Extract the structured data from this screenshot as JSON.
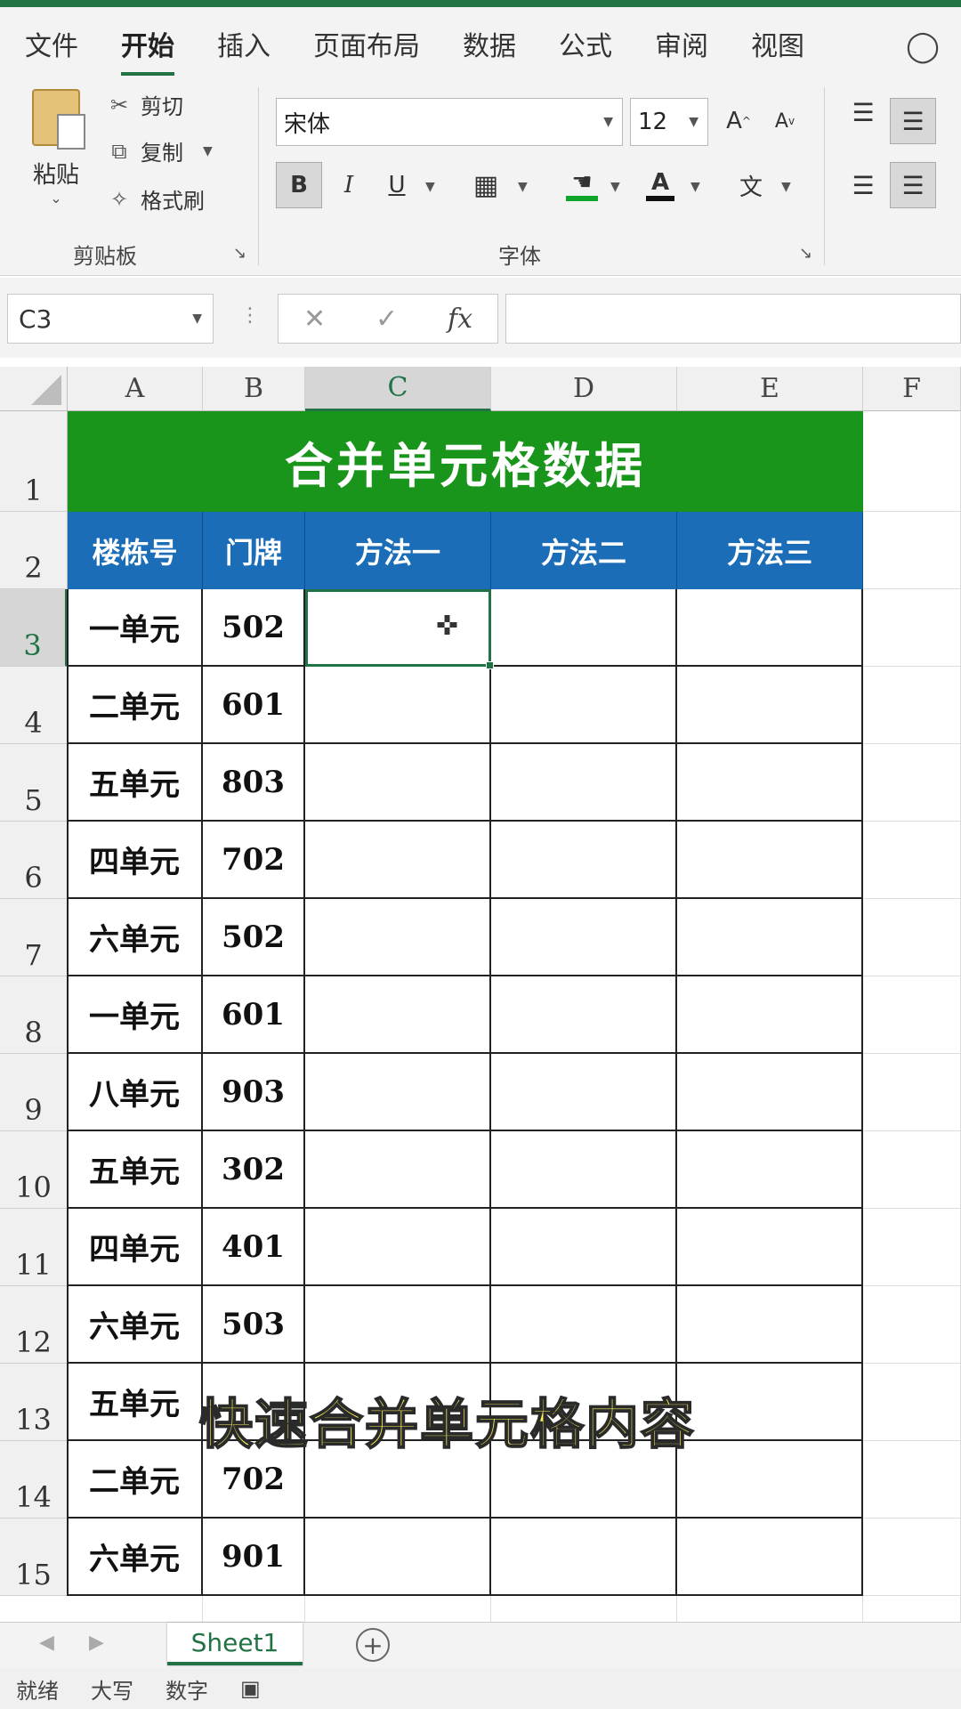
{
  "ribbon_tabs": [
    "文件",
    "开始",
    "插入",
    "页面布局",
    "数据",
    "公式",
    "审阅",
    "视图"
  ],
  "active_tab": "开始",
  "clipboard": {
    "paste_label": "粘贴",
    "cut_label": "剪切",
    "copy_label": "复制",
    "format_painter_label": "格式刷",
    "group_label": "剪贴板"
  },
  "font": {
    "font_name": "宋体",
    "font_size": "12",
    "group_label": "字体",
    "bold": "B",
    "italic": "I",
    "underline": "U",
    "grow": "A",
    "shrink": "A",
    "font_color": "A",
    "phonetic": "文"
  },
  "formula_bar": {
    "name_box": "C3",
    "cancel": "✕",
    "enter": "✓",
    "fx": "fx",
    "formula": ""
  },
  "columns": [
    "A",
    "B",
    "C",
    "D",
    "E",
    "F"
  ],
  "rows": [
    "1",
    "2",
    "3",
    "4",
    "5",
    "6",
    "7",
    "8",
    "9",
    "10",
    "11",
    "12",
    "13",
    "14",
    "15"
  ],
  "selected_cell": "C3",
  "title": "合并单元格数据",
  "headers": [
    "楼栋号",
    "门牌",
    "方法一",
    "方法二",
    "方法三"
  ],
  "table": [
    [
      "一单元",
      "502"
    ],
    [
      "二单元",
      "601"
    ],
    [
      "五单元",
      "803"
    ],
    [
      "四单元",
      "702"
    ],
    [
      "六单元",
      "502"
    ],
    [
      "一单元",
      "601"
    ],
    [
      "八单元",
      "903"
    ],
    [
      "五单元",
      "302"
    ],
    [
      "四单元",
      "401"
    ],
    [
      "六单元",
      "503"
    ],
    [
      "五单元",
      ""
    ],
    [
      "二单元",
      "702"
    ],
    [
      "六单元",
      "901"
    ]
  ],
  "caption": "快速合并单元格内容",
  "sheet": {
    "name": "Sheet1",
    "add": "+"
  },
  "status": [
    "就绪",
    "大写",
    "数字"
  ],
  "colors": {
    "title_bg": "#18951a",
    "header_bg": "#1b6db8",
    "accent": "#217346",
    "caption": "#fff35a"
  }
}
